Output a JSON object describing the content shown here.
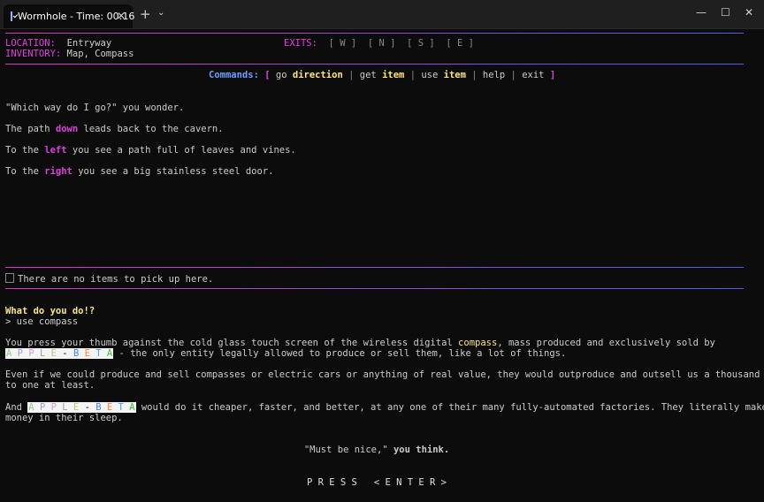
{
  "window": {
    "tab_title": "Wormhole - Time: 00:16",
    "close_tab": "✕",
    "new_tab": "+",
    "tab_dropdown": "⌄",
    "minimize": "—",
    "maximize": "☐",
    "close": "✕"
  },
  "header": {
    "location_label": "LOCATION:",
    "location_value": "Entryway",
    "inventory_label": "INVENTORY:",
    "inventory_value": "Map, Compass",
    "exits_label": "EXITS:",
    "exits": [
      "[ W ]",
      "[ N ]",
      "[ S ]",
      "[ E ]"
    ]
  },
  "commands": {
    "label": "Commands:",
    "open": "[",
    "close": "]",
    "sep": "|",
    "go": "go",
    "direction": "direction",
    "get": "get",
    "use": "use",
    "item": "item",
    "help": "help",
    "exit": "exit"
  },
  "room": {
    "line1": "\"Which way do I go?\" you wonder.",
    "line2_a": "The path ",
    "line2_kw": "down",
    "line2_b": " leads back to the cavern.",
    "line3_a": "To the ",
    "line3_kw": "left",
    "line3_b": " you see a path full of leaves and vines.",
    "line4_a": "To the ",
    "line4_kw": "right",
    "line4_b": " you see a big stainless steel door."
  },
  "items_status": "There are no items to pick up here.",
  "prompt": {
    "question": "What do you do!?",
    "input": "> use compass"
  },
  "response": {
    "p1_a": "You press your thumb against the cold glass touch screen of the wireless digital ",
    "p1_kw": "compass",
    "p1_b": ", mass produced and exclusively sold by",
    "brand_letters": [
      "A",
      "P",
      "P",
      "L",
      "E",
      "-",
      "B",
      "E",
      "T",
      "A"
    ],
    "p1_c": " - the only entity legally allowed to produce or sell them, like a lot of things.",
    "p2_a": "Even if we could produce and sell compasses or electric cars or anything of real value, they would outproduce and outsell us a thousand",
    "p2_b": "to one at least.",
    "p3_a": "And ",
    "p3_b": " would do it cheaper, faster, and better, at any one of their many fully-automated factories. They literally make",
    "p3_c": "money in their sleep.",
    "quote": "\"Must be nice,\"",
    "quote_tail": " you think.",
    "press_enter": "P R E S S   < E N T E R >"
  },
  "colors": {
    "background": "#0c0c0c",
    "keyword_magenta": "#e040e0",
    "keyword_yellow": "#ffe680",
    "commands_blue": "#6aa0ff"
  }
}
